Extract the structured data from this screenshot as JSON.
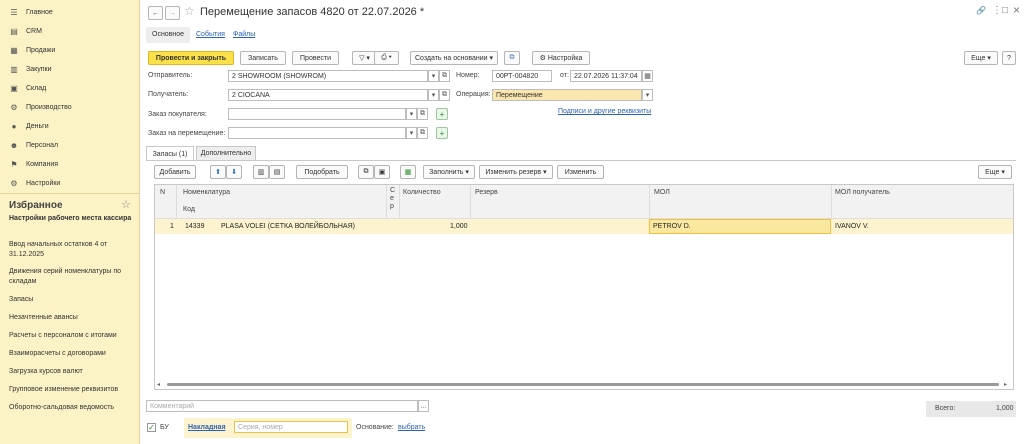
{
  "sidebar": {
    "nav": [
      {
        "label": "Главное",
        "icon": "menu-icon"
      },
      {
        "label": "CRM",
        "icon": "crm-icon"
      },
      {
        "label": "Продажи",
        "icon": "sales-icon"
      },
      {
        "label": "Закупки",
        "icon": "purchases-icon"
      },
      {
        "label": "Склад",
        "icon": "warehouse-icon"
      },
      {
        "label": "Производство",
        "icon": "production-icon"
      },
      {
        "label": "Деньги",
        "icon": "money-icon"
      },
      {
        "label": "Персонал",
        "icon": "staff-icon"
      },
      {
        "label": "Компания",
        "icon": "company-icon"
      },
      {
        "label": "Настройки",
        "icon": "settings-icon"
      }
    ],
    "favorites_title": "Избранное",
    "favorites": [
      {
        "label": "Настройки рабочего места кассира",
        "bold": true
      },
      {
        "label": "Ввод начальных остатков 4 от 31.12.2025"
      },
      {
        "label": "Движения серий номенклатуры по складам"
      },
      {
        "label": "Запасы"
      },
      {
        "label": "Незачтенные авансы"
      },
      {
        "label": "Расчеты с персоналом с итогами"
      },
      {
        "label": "Взаиморасчеты с договорами"
      },
      {
        "label": "Загрузка курсов валют"
      },
      {
        "label": "Групповое изменение реквизитов"
      },
      {
        "label": "Оборотно-сальдовая ведомость"
      }
    ]
  },
  "header": {
    "title": "Перемещение запасов 4820 от 22.07.2026 *",
    "nav_back": "←",
    "nav_forward": "→",
    "star": "☆",
    "link_icon": "🔗",
    "more": "⋮",
    "restore": "□",
    "close": "×"
  },
  "doc_tabs": [
    "Основное",
    "События",
    "Файлы"
  ],
  "toolbar": {
    "post_close": "Провести и закрыть",
    "save": "Записать",
    "post": "Провести",
    "create_based": "Создать на основании",
    "settings": "Настройка",
    "more": "Еще"
  },
  "form": {
    "sender_label": "Отправитель:",
    "sender_value": "2  SHOWROOM (SHOWROM)",
    "receiver_label": "Получатель:",
    "receiver_value": "2  CIOCANA",
    "customer_order_label": "Заказ покупателя:",
    "customer_order_value": "",
    "transfer_order_label": "Заказ на перемещение:",
    "transfer_order_value": "",
    "number_label": "Номер:",
    "number_value": "00РТ-004820",
    "date_label": "от:",
    "date_value": "22.07.2026 11:37:04",
    "operation_label": "Операция:",
    "operation_value": "Перемещение",
    "signatures_link": "Подписи и другие реквизиты"
  },
  "inner_tabs": [
    "Запасы (1)",
    "Дополнительно"
  ],
  "table_toolbar": {
    "add": "Добавить",
    "pick": "Подобрать",
    "fill": "Заполнить",
    "change_reserve": "Изменить резерв",
    "change": "Изменить",
    "more": "Еще"
  },
  "table": {
    "headers": {
      "n": "N",
      "nomenclature": "Номенклатура",
      "code": "Код",
      "series": "С е р",
      "quantity": "Количество",
      "reserve": "Резерв",
      "mol": "МОЛ",
      "mol_receiver": "МОЛ получатель"
    },
    "rows": [
      {
        "n": "1",
        "code": "14339",
        "name": "PLASA VOLEI (СЕТКА ВОЛЕЙБОЛЬНАЯ)",
        "quantity": "1,000",
        "reserve": "",
        "mol": "PETROV D.",
        "mol_receiver": "IVANOV V."
      }
    ]
  },
  "footer": {
    "comment_placeholder": "Комментарий",
    "total_label": "Всего:",
    "total_value": "1,000",
    "bu_label": "БУ",
    "invoice_label": "Накладная",
    "series_placeholder": "Серия, номер",
    "basis_label": "Основание:",
    "basis_link": "выбрать"
  },
  "colors": {
    "sidebar_bg": "#fbf2c5",
    "accent_yellow": "#fbe04a",
    "selected_row": "#fdf4cf",
    "link": "#2a62b5"
  }
}
